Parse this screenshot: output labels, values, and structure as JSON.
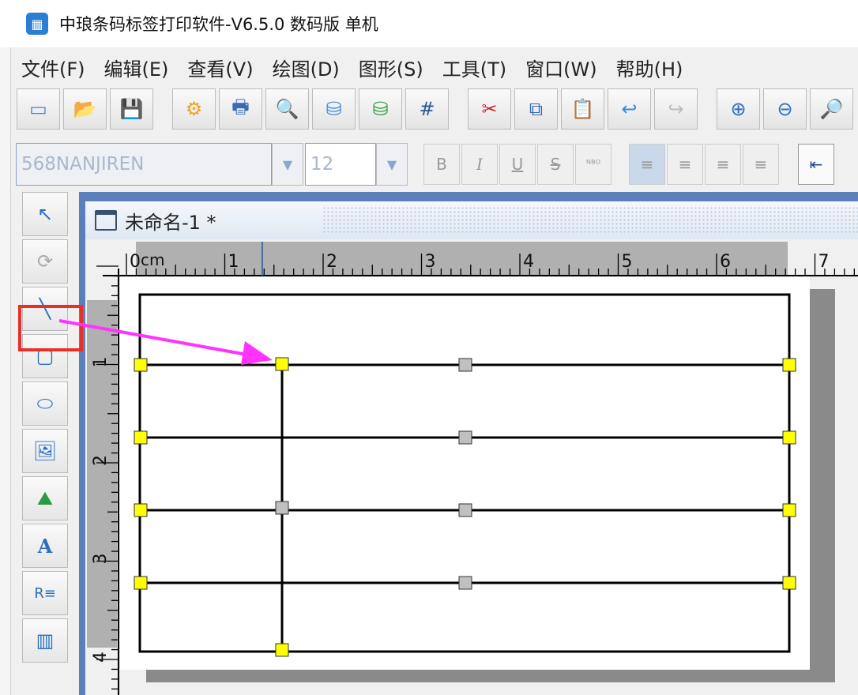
{
  "title": "中琅条码标签打印软件-V6.5.0 数码版 单机",
  "menu": [
    "文件(F)",
    "编辑(E)",
    "查看(V)",
    "绘图(D)",
    "图形(S)",
    "工具(T)",
    "窗口(W)",
    "帮助(H)"
  ],
  "toolbar": {
    "font_name": "568NANJIREN",
    "font_size": "12",
    "bold": "B",
    "italic": "I",
    "underline": "U",
    "strike": "S"
  },
  "document": {
    "tab_label": "未命名-1 *"
  },
  "ruler": {
    "unit": "cm",
    "h_labels": [
      "0",
      "1",
      "2",
      "3",
      "4",
      "5",
      "6",
      "7"
    ],
    "v_labels": [
      "1",
      "2",
      "3",
      "4"
    ]
  },
  "colors": {
    "accent": "#5b7fba",
    "handle_selected": "#ffff00",
    "handle_mid": "#c0c0c0",
    "highlight": "#e8302a",
    "arrow": "#ff33ff"
  }
}
